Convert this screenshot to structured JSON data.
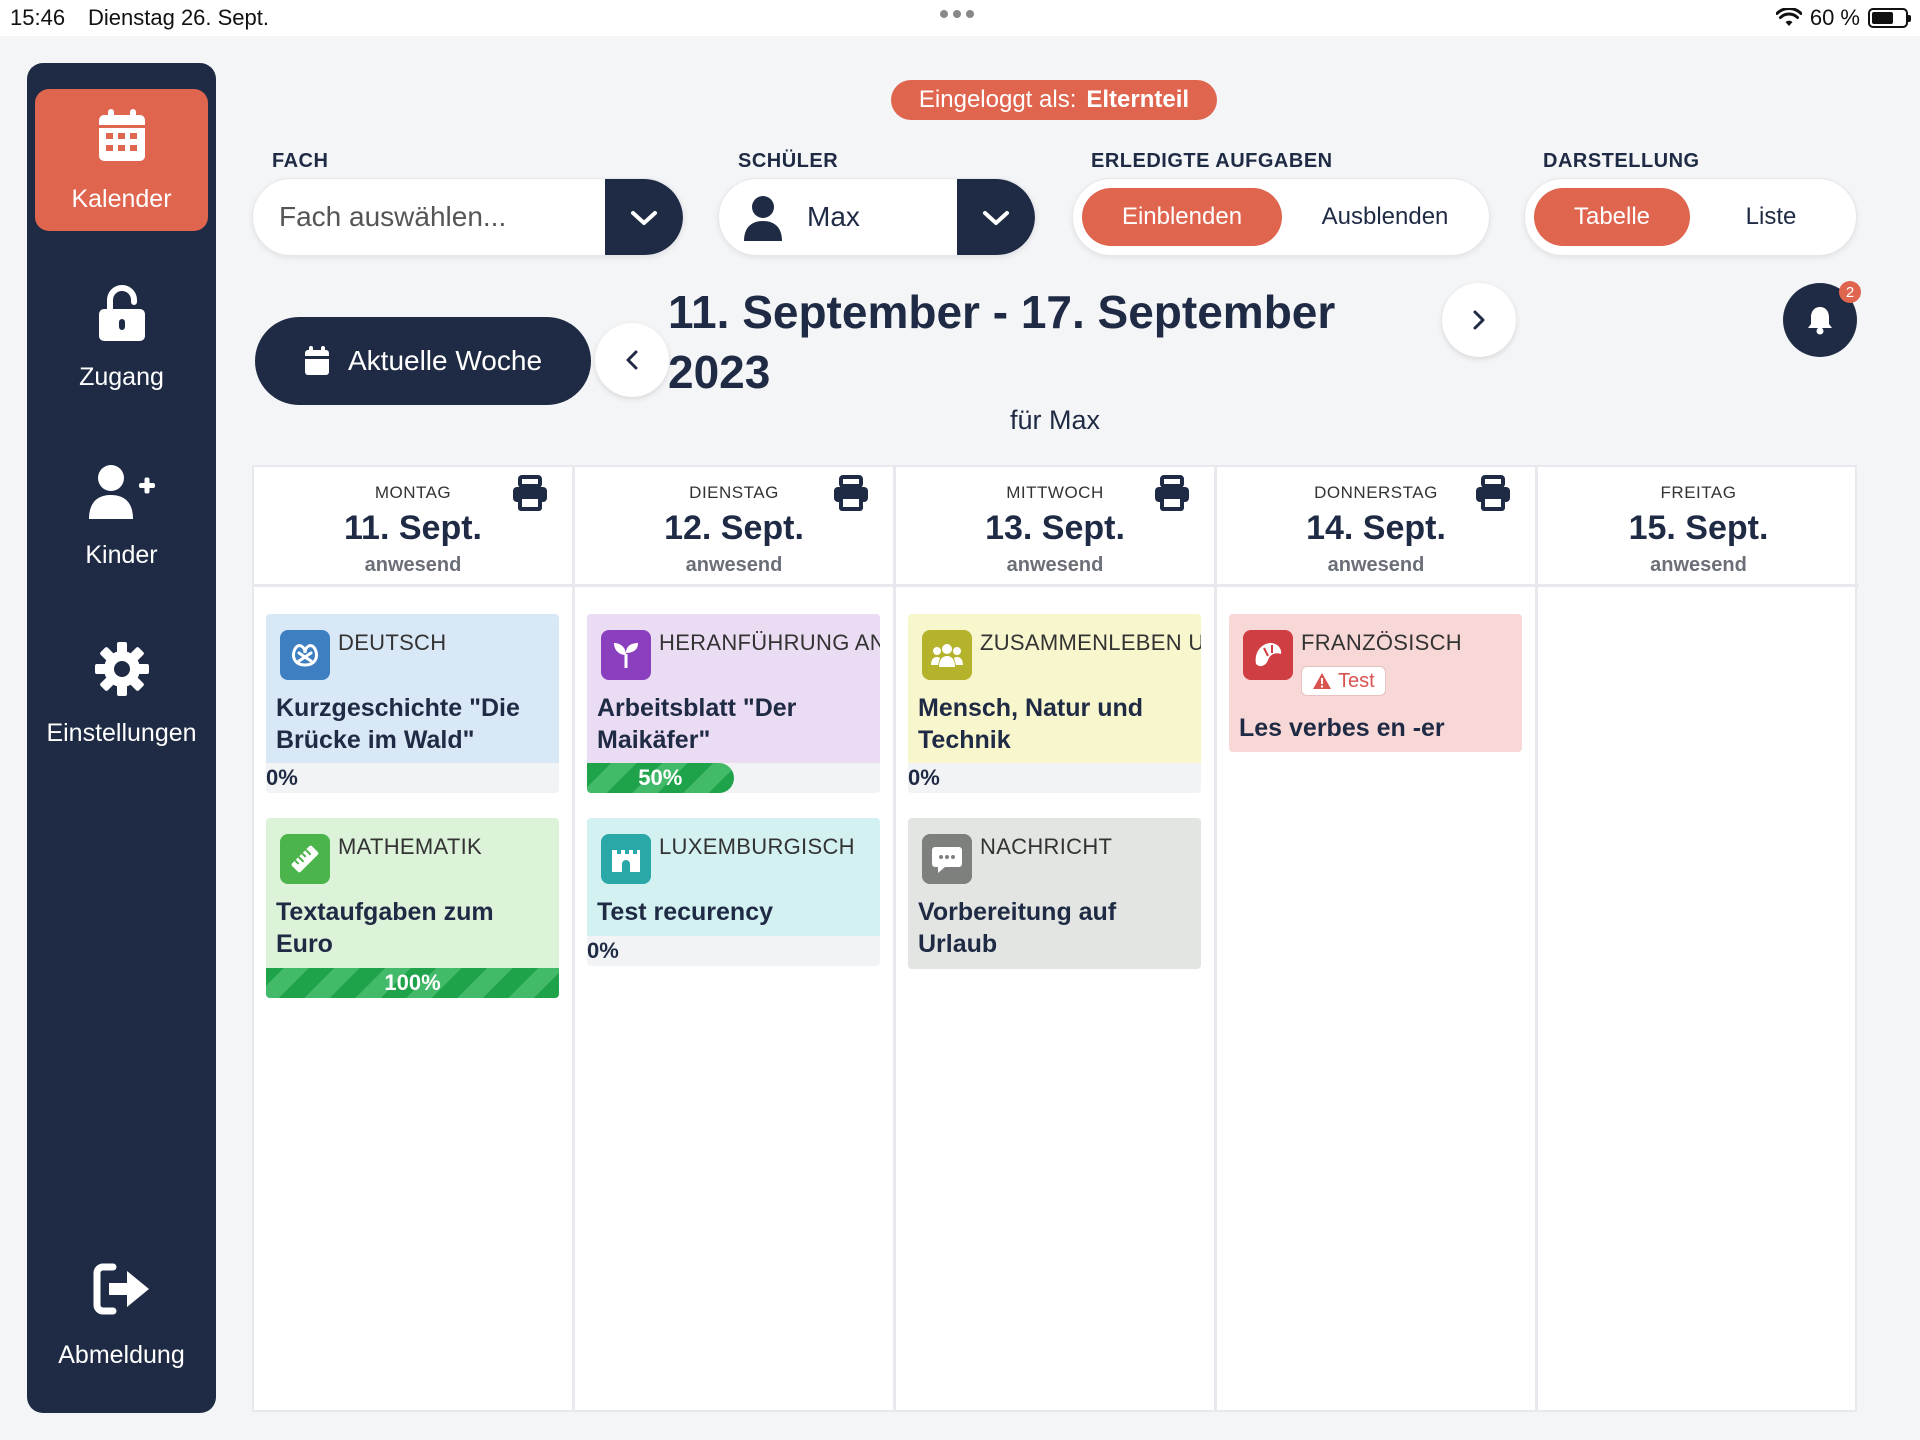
{
  "status_bar": {
    "time": "15:46",
    "date": "Dienstag 26. Sept.",
    "battery": "60 %",
    "battery_level": 0.6
  },
  "sidebar": {
    "items": [
      {
        "label": "Kalender",
        "icon": "calendar-icon",
        "active": true
      },
      {
        "label": "Zugang",
        "icon": "unlock-icon",
        "active": false
      },
      {
        "label": "Kinder",
        "icon": "user-plus-icon",
        "active": false
      },
      {
        "label": "Einstellungen",
        "icon": "gear-icon",
        "active": false
      }
    ],
    "logout": {
      "label": "Abmeldung",
      "icon": "logout-icon"
    }
  },
  "login": {
    "prefix": "Eingeloggt als:",
    "role": "Elternteil"
  },
  "filters": {
    "subject": {
      "label": "FACH",
      "placeholder": "Fach auswählen..."
    },
    "student": {
      "label": "SCHÜLER",
      "value": "Max"
    },
    "done_tasks": {
      "label": "ERLEDIGTE AUFGABEN",
      "options": [
        "Einblenden",
        "Ausblenden"
      ],
      "selected": "Einblenden"
    },
    "view": {
      "label": "DARSTELLUNG",
      "options": [
        "Tabelle",
        "Liste"
      ],
      "selected": "Tabelle"
    }
  },
  "week": {
    "current_button": "Aktuelle Woche",
    "title_line1": "11. September - 17. September",
    "title_line2": "2023",
    "subtitle": "für Max",
    "notifications": "2"
  },
  "colors": {
    "accent": "#e0654f",
    "navy": "#1f2b44",
    "progress": "#1fa34a"
  },
  "days": [
    {
      "weekday": "MONTAG",
      "date": "11. Sept.",
      "status": "anwesend",
      "printable": true,
      "cards": [
        {
          "subject": "DEUTSCH",
          "icon": "pretzel-icon",
          "title": "Kurzgeschichte \"Die Brücke im Wald\"",
          "progress": "0%",
          "progress_value": 0
        },
        {
          "subject": "MATHEMATIK",
          "icon": "ruler-icon",
          "title": "Textaufgaben zum Euro",
          "progress": "100%",
          "progress_value": 100
        }
      ]
    },
    {
      "weekday": "DIENSTAG",
      "date": "12. Sept.",
      "status": "anwesend",
      "printable": true,
      "cards": [
        {
          "subject": "HERANFÜHRUNG AN",
          "icon": "sprout-icon",
          "title": "Arbeitsblatt \"Der Maikäfer\"",
          "progress": "50%",
          "progress_value": 50
        },
        {
          "subject": "LUXEMBURGISCH",
          "icon": "castle-icon",
          "title": "Test recurency",
          "progress": "0%",
          "progress_value": 0
        }
      ]
    },
    {
      "weekday": "MITTWOCH",
      "date": "13. Sept.",
      "status": "anwesend",
      "printable": true,
      "cards": [
        {
          "subject": "ZUSAMMENLEBEN U",
          "icon": "people-icon",
          "title": "Mensch, Natur und Technik",
          "progress": "0%",
          "progress_value": 0
        },
        {
          "subject": "NACHRICHT",
          "icon": "message-icon",
          "title": "Vorbereitung auf Urlaub"
        }
      ]
    },
    {
      "weekday": "DONNERSTAG",
      "date": "14. Sept.",
      "status": "anwesend",
      "printable": true,
      "cards": [
        {
          "subject": "FRANZÖSISCH",
          "icon": "croissant-icon",
          "badge": "Test",
          "title": "Les verbes en -er"
        }
      ]
    },
    {
      "weekday": "FREITAG",
      "date": "15. Sept.",
      "status": "anwesend",
      "printable": false,
      "cards": []
    }
  ]
}
